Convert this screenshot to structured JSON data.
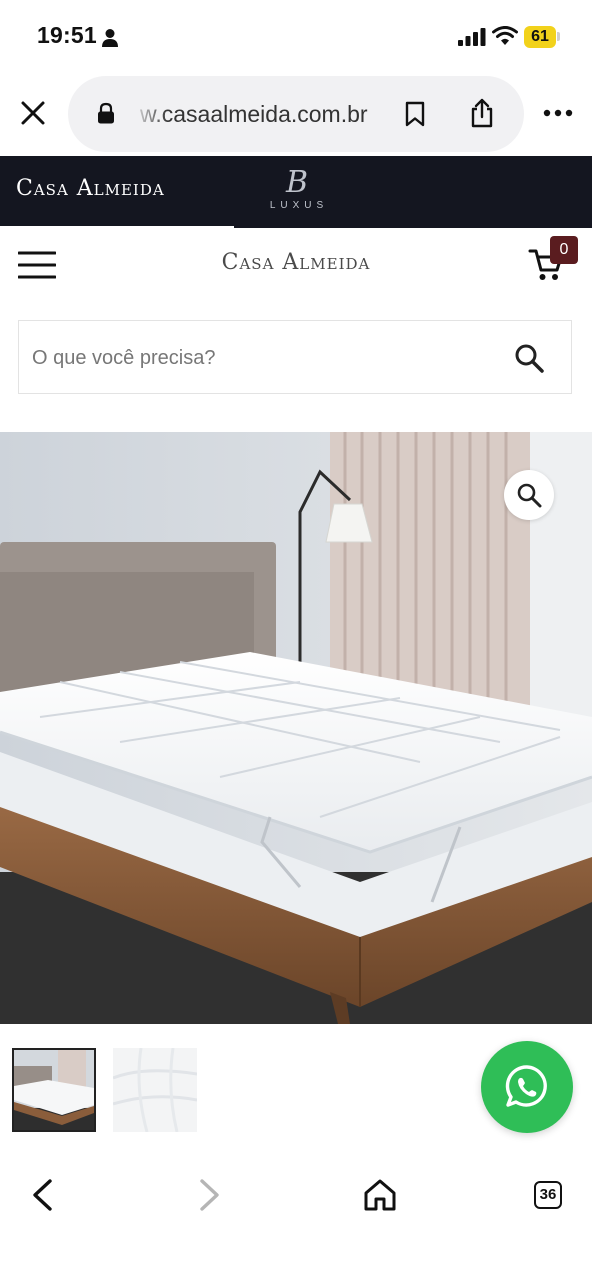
{
  "status_bar": {
    "time": "19:51",
    "battery": "61"
  },
  "browser": {
    "url": "w.casaalmeida.com.br",
    "tab_count": "36"
  },
  "brand_strip": {
    "brand_name": "Casa Almeida",
    "luxus_letter": "B",
    "luxus_word": "LUXUS"
  },
  "header": {
    "logo": "Casa Almeida",
    "cart_count": "0"
  },
  "search": {
    "placeholder": "O que você precisa?"
  },
  "colors": {
    "brand_dark": "#141620",
    "cart_badge": "#5a1c1f",
    "whatsapp": "#2fbe57",
    "battery": "#f2d21b"
  }
}
